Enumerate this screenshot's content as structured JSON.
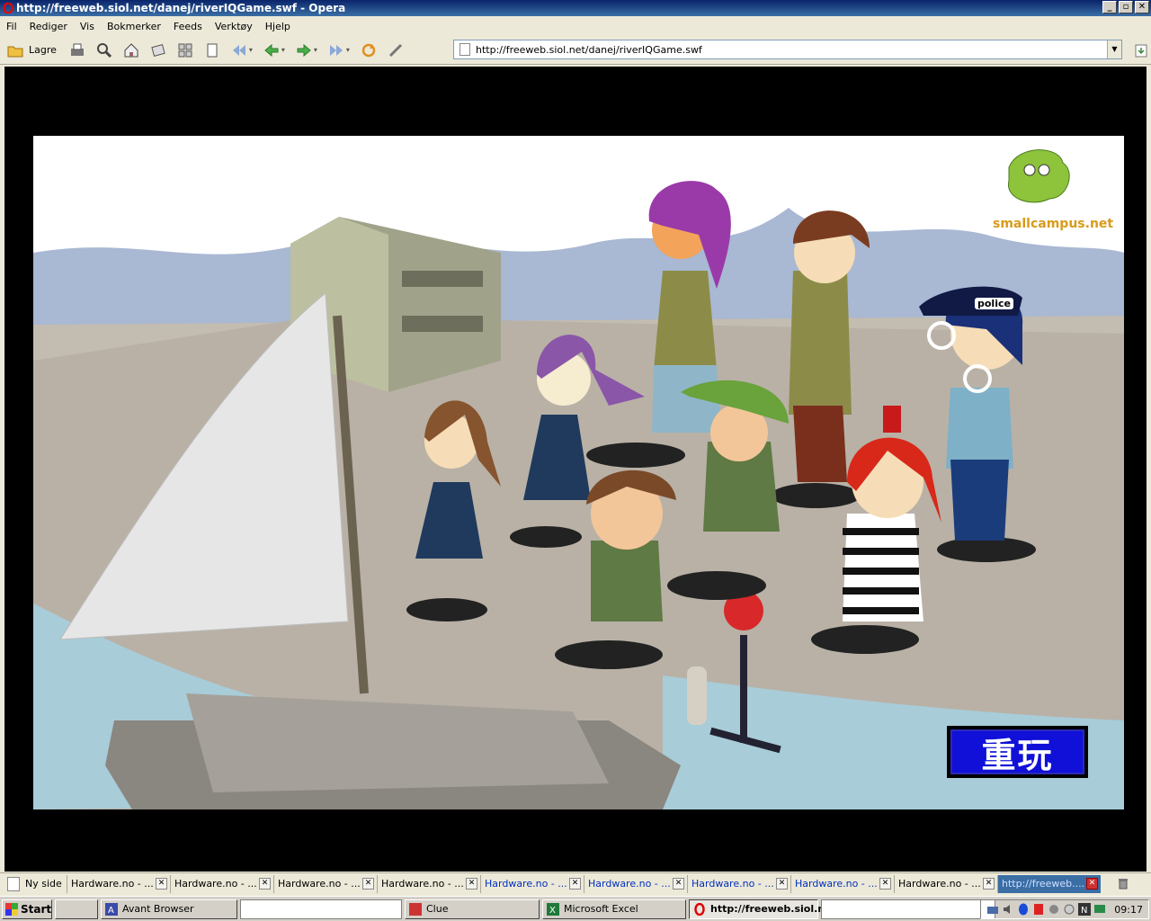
{
  "window": {
    "title": "http://freeweb.siol.net/danej/riverIQGame.swf - Opera",
    "controls": {
      "minimize": "_",
      "maximize": "▫",
      "close": "✕"
    }
  },
  "menu": [
    "Fil",
    "Rediger",
    "Vis",
    "Bokmerker",
    "Feeds",
    "Verktøy",
    "Hjelp"
  ],
  "toolbar": {
    "save_label": "Lagre",
    "address": "http://freeweb.siol.net/danej/riverIQGame.swf"
  },
  "game": {
    "logo_brand": "SmallCampus.net",
    "logo_url": "smallcampus.net",
    "police_label": "police",
    "replay_label": "重玩"
  },
  "tabs": {
    "new_tab": "Ny side",
    "items": [
      {
        "label": "Hardware.no - ...",
        "style": "normal"
      },
      {
        "label": "Hardware.no - ...",
        "style": "normal"
      },
      {
        "label": "Hardware.no - ...",
        "style": "normal"
      },
      {
        "label": "Hardware.no - ...",
        "style": "normal"
      },
      {
        "label": "Hardware.no - ...",
        "style": "blue"
      },
      {
        "label": "Hardware.no - ...",
        "style": "blue"
      },
      {
        "label": "Hardware.no - ...",
        "style": "blue"
      },
      {
        "label": "Hardware.no - ...",
        "style": "blue"
      },
      {
        "label": "Hardware.no - ...",
        "style": "normal"
      },
      {
        "label": "http://freeweb....",
        "style": "active"
      }
    ]
  },
  "taskbar": {
    "start": "Start",
    "tasks": [
      {
        "label": "Avant Browser",
        "icon": "avant-icon"
      },
      {
        "label": "",
        "icon": ""
      },
      {
        "label": "Clue",
        "icon": "clue-icon"
      },
      {
        "label": "Microsoft Excel",
        "icon": "excel-icon"
      },
      {
        "label": "http://freeweb.siol.n...",
        "icon": "opera-icon"
      },
      {
        "label": "",
        "icon": ""
      }
    ],
    "clock": "09:17"
  }
}
